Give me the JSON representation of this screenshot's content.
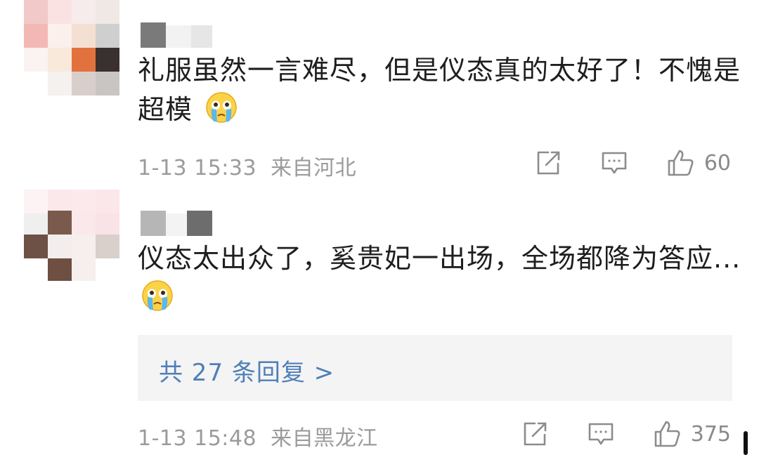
{
  "comments": [
    {
      "text": "礼服虽然一言难尽，但是仪态真的太好了！不愧是超模",
      "emoji": "crying-face-emoji",
      "time": "1-13 15:33",
      "location": "来自河北",
      "likes": "60"
    },
    {
      "text": "仪态太出众了，奚贵妃一出场，全场都降为答应...",
      "emoji": "crying-face-emoji",
      "time": "1-13 15:48",
      "location": "来自黑龙江",
      "likes": "375",
      "replies_link": "共 27 条回复 >"
    }
  ],
  "icons": {
    "share": "share-icon",
    "reply": "comment-icon",
    "like": "thumbs-up-icon"
  },
  "colors": {
    "meta_gray": "#9b9b9b",
    "link_blue": "#4f7fb8",
    "reply_bg": "#f4f4f4"
  }
}
